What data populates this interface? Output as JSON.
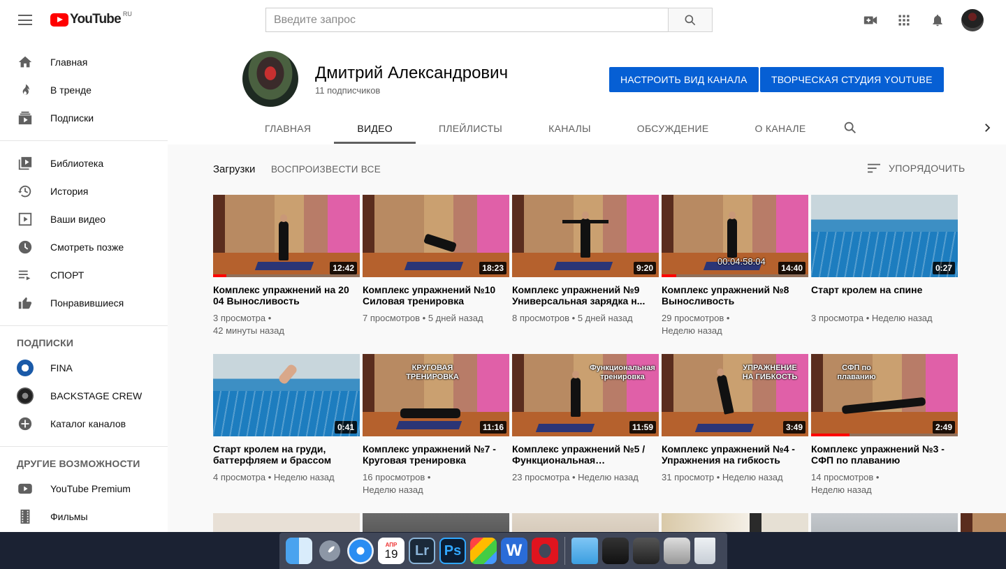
{
  "header": {
    "logo_text": "YouTube",
    "logo_region": "RU",
    "search_placeholder": "Введите запрос"
  },
  "sidebar": {
    "main": [
      {
        "label": "Главная",
        "icon": "home-icon"
      },
      {
        "label": "В тренде",
        "icon": "fire-icon"
      },
      {
        "label": "Подписки",
        "icon": "subscriptions-icon"
      }
    ],
    "library": [
      {
        "label": "Библиотека",
        "icon": "library-icon"
      },
      {
        "label": "История",
        "icon": "history-icon"
      },
      {
        "label": "Ваши видео",
        "icon": "your-videos-icon"
      },
      {
        "label": "Смотреть позже",
        "icon": "clock-icon"
      },
      {
        "label": "СПОРТ",
        "icon": "playlist-icon"
      },
      {
        "label": "Понравившиеся",
        "icon": "thumb-up-icon"
      }
    ],
    "subscriptions_heading": "ПОДПИСКИ",
    "subscriptions": [
      {
        "label": "FINA"
      },
      {
        "label": "BACKSTAGE CREW"
      },
      {
        "label": "Каталог каналов"
      }
    ],
    "more_heading": "ДРУГИЕ ВОЗМОЖНОСТИ",
    "more": [
      {
        "label": "YouTube Premium"
      },
      {
        "label": "Фильмы"
      }
    ]
  },
  "channel": {
    "name": "Дмитрий Александрович",
    "subscribers": "11 подписчиков",
    "customize_button": "НАСТРОИТЬ ВИД КАНАЛА",
    "studio_button": "ТВОРЧЕСКАЯ СТУДИЯ YOUTUBE",
    "tabs": [
      "ГЛАВНАЯ",
      "ВИДЕО",
      "ПЛЕЙЛИСТЫ",
      "КАНАЛЫ",
      "ОБСУЖДЕНИЕ",
      "О КАНАЛЕ"
    ],
    "active_tab": "ВИДЕО"
  },
  "content": {
    "section_title": "Загрузки",
    "play_all": "ВОСПРОИЗВЕСТИ ВСЕ",
    "sort_label": "УПОРЯДОЧИТЬ",
    "videos": [
      {
        "title": "Комплекс упражнений на 20 04 Выносливость",
        "views": "3 просмотра",
        "age": "42 минуты назад",
        "duration": "12:42",
        "progress": 0.09,
        "overlay": ""
      },
      {
        "title": "Комплекс упражнений №10 Силовая тренировка",
        "views": "7 просмотров",
        "age": "5 дней назад",
        "duration": "18:23",
        "progress": 0,
        "overlay": ""
      },
      {
        "title": "Комплекс упражнений №9 Универсальная зарядка н...",
        "views": "8 просмотров",
        "age": "5 дней назад",
        "duration": "9:20",
        "progress": 0,
        "overlay": ""
      },
      {
        "title": "Комплекс упражнений №8 Выносливость",
        "views": "29 просмотров",
        "age": "Неделю назад",
        "duration": "14:40",
        "progress": 0.1,
        "overlay": "00:04:58:04"
      },
      {
        "title": "Старт кролем на спине",
        "views": "3 просмотра",
        "age": "Неделю назад",
        "duration": "0:27",
        "progress": 0,
        "overlay": ""
      },
      {
        "title": "Старт кролем на груди, баттерфляем и брассом",
        "views": "4 просмотра",
        "age": "Неделю назад",
        "duration": "0:41",
        "progress": 0,
        "overlay": ""
      },
      {
        "title": "Комплекс упражнений №7 - Круговая тренировка",
        "views": "16 просмотров",
        "age": "Неделю назад",
        "duration": "11:16",
        "progress": 0,
        "overlay": "КРУГОВАЯ ТРЕНИРОВКА"
      },
      {
        "title": "Комплекс упражнений №5 / Функциональная…",
        "views": "23 просмотра",
        "age": "Неделю назад",
        "duration": "11:59",
        "progress": 0,
        "overlay": "Функциональная тренировка"
      },
      {
        "title": "Комплекс упражнений №4 - Упражнения на гибкость",
        "views": "31 просмотр",
        "age": "Неделю назад",
        "duration": "3:49",
        "progress": 0,
        "overlay": "УПРАЖНЕНИЕ НА ГИБКОСТЬ"
      },
      {
        "title": "Комплекс упражнений №3 - СФП по плаванию",
        "views": "14 просмотров",
        "age": "Неделю назад",
        "duration": "2:49",
        "progress": 0.26,
        "overlay": "СФП по плаванию"
      }
    ]
  },
  "dock": {
    "calendar_month": "АПР",
    "calendar_day": "19",
    "lightroom": "Lr",
    "photoshop": "Ps"
  }
}
